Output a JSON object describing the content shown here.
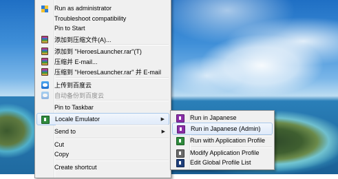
{
  "main_menu": {
    "items": [
      {
        "label": "Run as administrator",
        "icon": "shield-icon"
      },
      {
        "label": "Troubleshoot compatibility"
      },
      {
        "label": "Pin to Start"
      },
      {
        "label": "添加到压缩文件(A)...",
        "icon": "winrar-icon"
      },
      {
        "label": "添加到 \"HeroesLauncher.rar\"(T)",
        "icon": "winrar-icon"
      },
      {
        "label": "压缩并 E-mail...",
        "icon": "winrar-icon"
      },
      {
        "label": "压缩到 \"HeroesLauncher.rar\" 并 E-mail",
        "icon": "winrar-icon"
      },
      {
        "label": "上传到百度云",
        "icon": "baidu-cloud-icon"
      },
      {
        "label": "自动备份到百度云",
        "icon": "baidu-cloud-icon",
        "disabled": true
      },
      {
        "label": "Pin to Taskbar"
      },
      {
        "label": "Locale Emulator",
        "icon": "locale-emulator-icon",
        "submenu": true
      },
      {
        "label": "Send to",
        "submenu": true
      },
      {
        "label": "Cut"
      },
      {
        "label": "Copy"
      },
      {
        "label": "Create shortcut"
      }
    ]
  },
  "sub_menu": {
    "items": [
      {
        "label": "Run in Japanese",
        "icon": "locale-purple-icon"
      },
      {
        "label": "Run in Japanese (Admin)",
        "icon": "locale-purple-icon",
        "hovered": true
      },
      {
        "label": "Run with Application Profile",
        "icon": "locale-green-icon"
      },
      {
        "label": "Modify Application Profile",
        "icon": "locale-gray-icon"
      },
      {
        "label": "Edit Global Profile List",
        "icon": "locale-dark-icon"
      }
    ]
  },
  "colors": {
    "menu_bg": "#f0f0f0",
    "menu_border": "#979797",
    "hover_fill": "#dfeafa",
    "hover_border": "#a8c8ea",
    "disabled_text": "#8f8f8f"
  }
}
